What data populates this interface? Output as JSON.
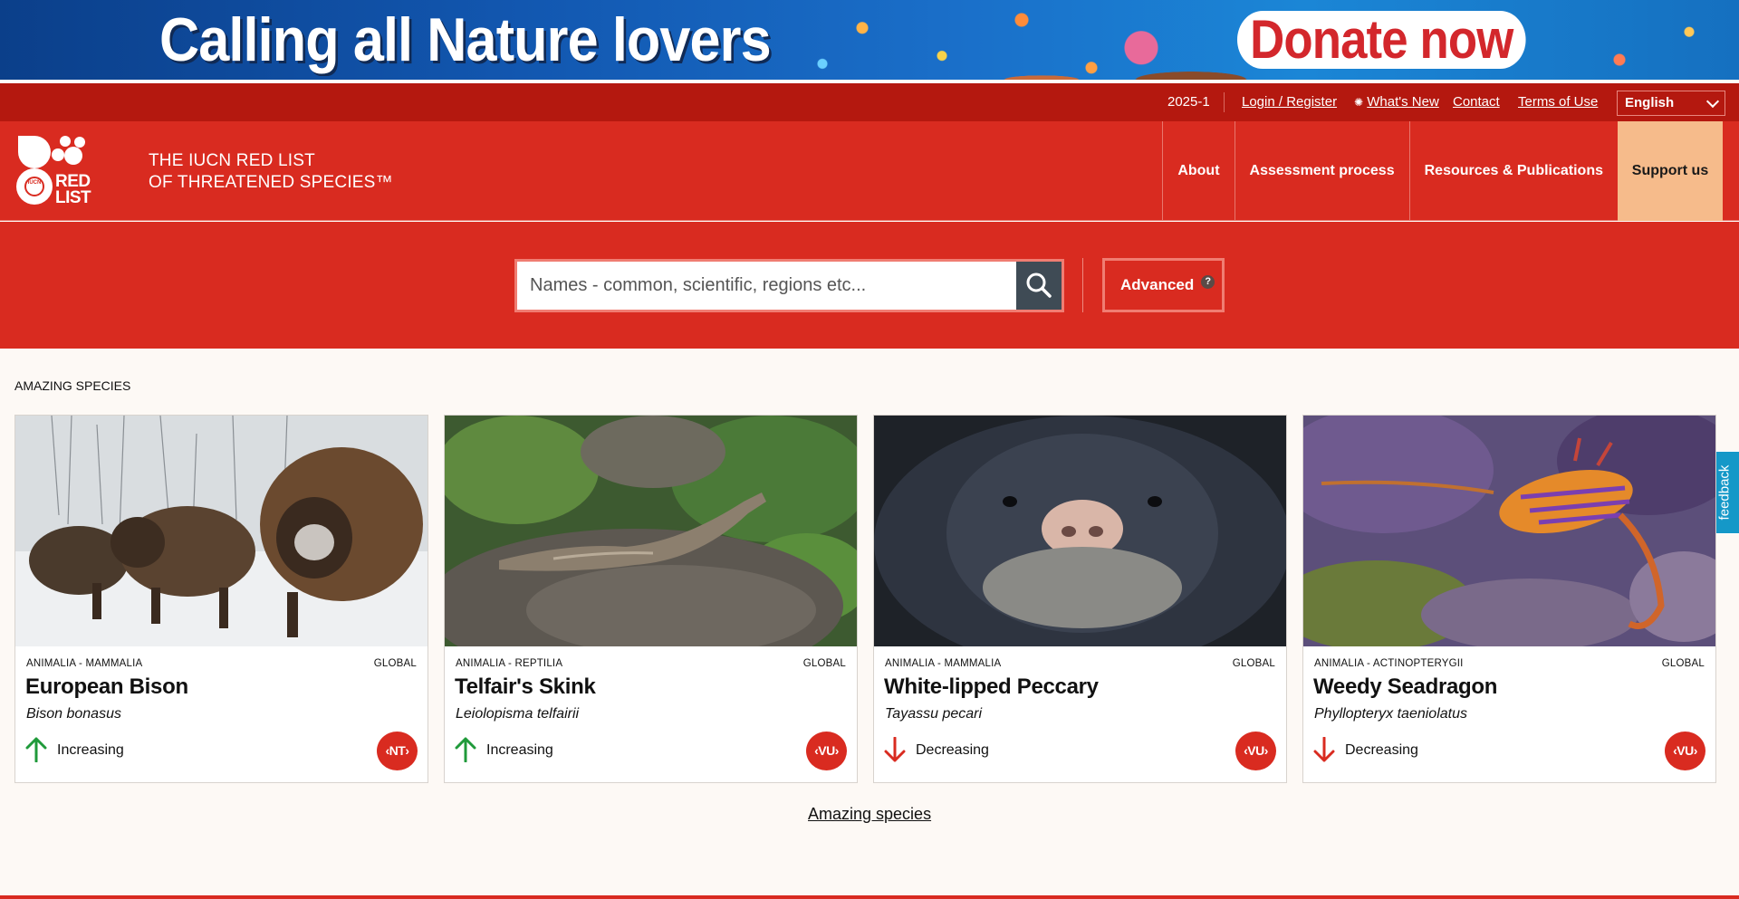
{
  "banner": {
    "title": "Calling all Nature lovers",
    "donate_label": "Donate now"
  },
  "util_bar": {
    "version": "2025-1",
    "login_label": "Login / Register",
    "whats_new_label": "What's New",
    "contact_label": "Contact",
    "terms_label": "Terms of Use",
    "language": "English"
  },
  "header": {
    "logo_text": [
      "RED",
      "LIST"
    ],
    "logo_badge": "IUCN",
    "site_title_line1": "THE IUCN RED LIST",
    "site_title_line2": "OF THREATENED SPECIES™",
    "nav": [
      {
        "label": "About"
      },
      {
        "label": "Assessment process"
      },
      {
        "label": "Resources & Publications"
      },
      {
        "label": "Support us"
      }
    ]
  },
  "search": {
    "placeholder": "Names - common, scientific, regions etc...",
    "advanced_label": "Advanced",
    "help_mark": "?"
  },
  "feedback_label": "feedback",
  "species_section": {
    "label": "AMAZING SPECIES",
    "cards": [
      {
        "taxon": "ANIMALIA - MAMMALIA",
        "scope": "GLOBAL",
        "common_name": "European Bison",
        "scientific_name": "Bison bonasus",
        "trend": "Increasing",
        "trend_dir": "up",
        "status": "NT"
      },
      {
        "taxon": "ANIMALIA - REPTILIA",
        "scope": "GLOBAL",
        "common_name": "Telfair's Skink",
        "scientific_name": "Leiolopisma telfairii",
        "trend": "Increasing",
        "trend_dir": "up",
        "status": "VU"
      },
      {
        "taxon": "ANIMALIA - MAMMALIA",
        "scope": "GLOBAL",
        "common_name": "White-lipped Peccary",
        "scientific_name": "Tayassu pecari",
        "trend": "Decreasing",
        "trend_dir": "down",
        "status": "VU"
      },
      {
        "taxon": "ANIMALIA - ACTINOPTERYGII",
        "scope": "GLOBAL",
        "common_name": "Weedy Seadragon",
        "scientific_name": "Phyllopteryx taeniolatus",
        "trend": "Decreasing",
        "trend_dir": "down",
        "status": "VU"
      }
    ],
    "link_label": "Amazing species"
  },
  "colors": {
    "brand_red": "#d92b20",
    "dark_red": "#b4180f",
    "support_bg": "#f6bb8b",
    "trend_up": "#1f9a3a",
    "trend_down": "#d92b20",
    "feedback_blue": "#1598c8"
  }
}
